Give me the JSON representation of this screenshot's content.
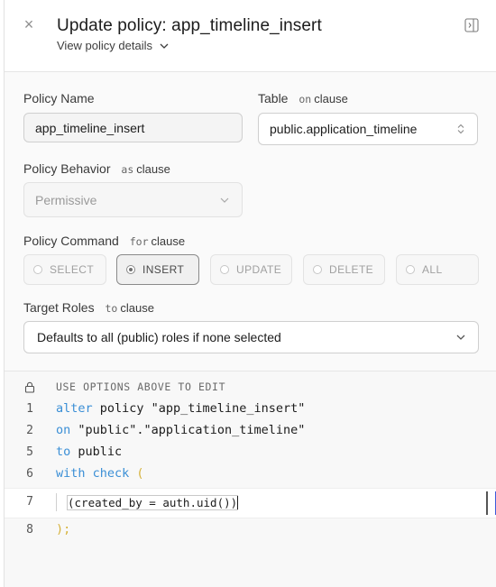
{
  "header": {
    "title": "Update policy: app_timeline_insert",
    "details_link": "View policy details",
    "close_glyph": "×"
  },
  "form": {
    "policy_name": {
      "label": "Policy Name",
      "value": "app_timeline_insert"
    },
    "table": {
      "label": "Table",
      "clause_keyword": "on",
      "clause_word": "clause",
      "value": "public.application_timeline"
    },
    "behavior": {
      "label": "Policy Behavior",
      "clause_keyword": "as",
      "clause_word": "clause",
      "value": "Permissive"
    },
    "command": {
      "label": "Policy Command",
      "clause_keyword": "for",
      "clause_word": "clause",
      "options": [
        "SELECT",
        "INSERT",
        "UPDATE",
        "DELETE",
        "ALL"
      ],
      "selected": "INSERT"
    },
    "roles": {
      "label": "Target Roles",
      "clause_keyword": "to",
      "clause_word": "clause",
      "value": "Defaults to all (public) roles if none selected"
    }
  },
  "editor": {
    "readonly_note": "USE OPTIONS ABOVE TO EDIT",
    "lines": [
      {
        "num": "1",
        "kw": "alter",
        "rest": " policy \"app_timeline_insert\""
      },
      {
        "num": "2",
        "kw": "on",
        "rest": " \"public\".\"application_timeline\""
      },
      {
        "num": "5",
        "kw": "to",
        "rest": " public"
      },
      {
        "num": "6",
        "kw": "with check",
        "rest": " ("
      }
    ],
    "active_line_num": "7",
    "active_code": "(created_by = auth.uid())",
    "closing_line_num": "8",
    "closing_code": ");"
  },
  "colors": {
    "keyword": "#3b8fd6",
    "paren": "#d6b23b",
    "accent_blue": "#3b5bdb"
  },
  "icons": [
    "close-icon",
    "chevron-down-icon",
    "sidebar-toggle-icon",
    "select-chevrons-icon",
    "lock-icon"
  ]
}
